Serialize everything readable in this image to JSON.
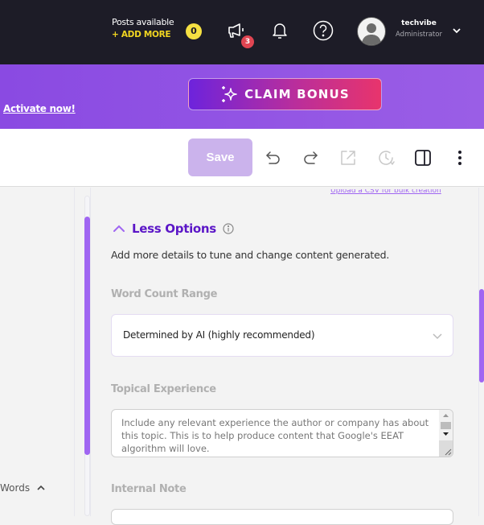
{
  "topbar": {
    "posts_label": "Posts available",
    "add_more_label": "+ ADD MORE",
    "posts_count": "0",
    "announcements_badge": "3",
    "user": {
      "name": "techvibe",
      "role": "Administrator"
    },
    "icons": [
      "megaphone-icon",
      "bell-icon",
      "help-icon",
      "avatar",
      "chevron-down-icon"
    ]
  },
  "promo": {
    "activate_label": "Activate now!",
    "claim_label": "CLAIM BONUS",
    "claim_icon": "sparkle-icon"
  },
  "toolbar": {
    "save_label": "Save",
    "icons": [
      "undo-icon",
      "redo-icon",
      "external-link-icon",
      "history-icon",
      "sidebar-toggle-icon",
      "more-vertical-icon"
    ]
  },
  "left_panel": {
    "words_label": "Words"
  },
  "form": {
    "upload_link": "Upload a CSV for bulk creation",
    "less_options_label": "Less Options",
    "description": "Add more details to tune and change content generated.",
    "word_count": {
      "label": "Word Count Range",
      "value": "Determined by AI (highly recommended)"
    },
    "topical_experience": {
      "label": "Topical Experience",
      "placeholder": "Include any relevant experience the author or company has about this topic. This is to help produce content that Google's EEAT algorithm will love."
    },
    "internal_note": {
      "label": "Internal Note"
    }
  },
  "colors": {
    "accent": "#a066f2",
    "accent_dark": "#5b16c7",
    "topbar_bg": "#1d1c27",
    "badge_yellow": "#f5e042",
    "badge_red": "#e04552"
  }
}
